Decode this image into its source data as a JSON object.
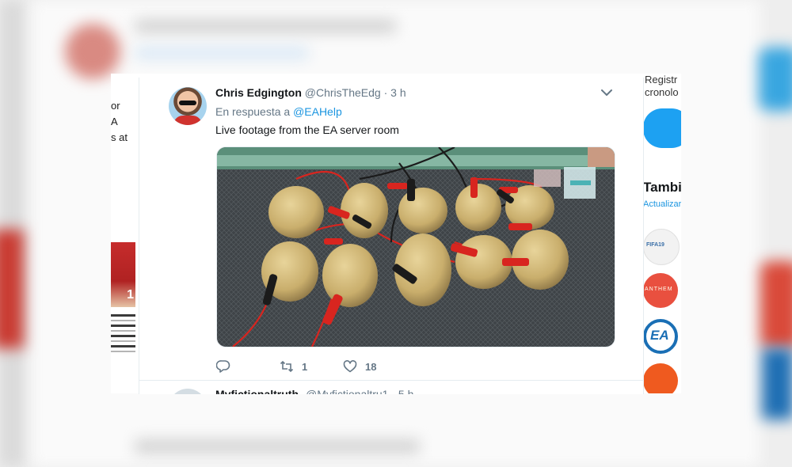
{
  "tweet": {
    "author_name": "Chris Edgington",
    "author_handle": "@ChrisTheEdg",
    "separator": "·",
    "time": "3 h",
    "reply_prefix": "En respuesta a",
    "reply_mention": "@EAHelp",
    "text": "Live footage from the EA server room",
    "retweet_count": "1",
    "like_count": "18"
  },
  "next_tweet": {
    "author_name": "Myfictionaltruth",
    "author_handle": "@Myfictionaltru1 · 5 h"
  },
  "left_column": {
    "lines": [
      "or",
      "A",
      "s at"
    ],
    "image_badge": "1"
  },
  "right_column": {
    "line1": "Registr",
    "line2": "cronolo",
    "heading": "Tambi",
    "subtext": "Actualizar",
    "logos": [
      {
        "name": "fifa-logo",
        "label": "FIFA19"
      },
      {
        "name": "anthem-logo",
        "label": "ANTHEM"
      },
      {
        "name": "ea-logo",
        "label": "EA"
      },
      {
        "name": "origin-logo",
        "label": ""
      }
    ]
  },
  "colors": {
    "link": "#1b95e0",
    "secondary_text": "#657786",
    "primary_text": "#14171a",
    "twitter_blue": "#1da1f2"
  },
  "icons": [
    "reply-icon",
    "retweet-icon",
    "like-icon",
    "chevron-down-icon"
  ]
}
